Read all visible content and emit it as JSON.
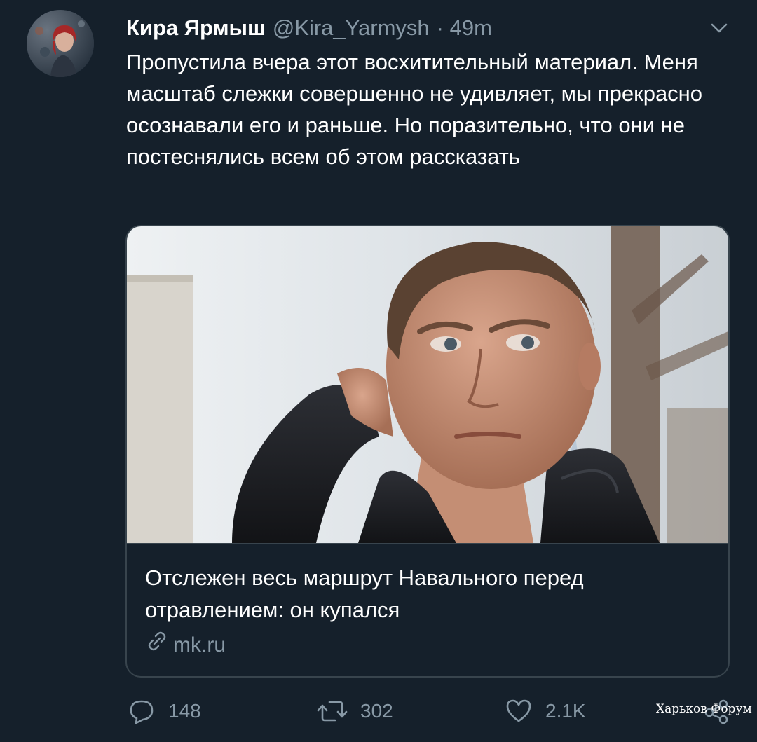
{
  "author": {
    "display_name": "Кира Ярмыш",
    "handle": "@Kira_Yarmysh",
    "time": "· 49m"
  },
  "tweet": {
    "text": "Пропустила вчера этот восхитительный материал. Меня масштаб слежки совершенно не удивляет, мы прекрасно осознавали его и раньше. Но поразительно, что они не постеснялись всем об этом рассказать"
  },
  "card": {
    "title": "Отслежен весь маршрут Навального перед отравлением: он купался",
    "domain": "mk.ru"
  },
  "actions": {
    "replies": "148",
    "retweets": "302",
    "likes": "2.1K"
  },
  "watermark": "Харьков Форум",
  "icons": {
    "avatar": "profile-photo",
    "menu": "chevron-down-icon",
    "link": "link-icon",
    "reply": "reply-icon",
    "retweet": "retweet-icon",
    "like": "heart-icon",
    "share": "share-icon"
  },
  "colors": {
    "background": "#15202b",
    "text_primary": "#ffffff",
    "text_secondary": "#8899a6",
    "border": "#38444d"
  }
}
